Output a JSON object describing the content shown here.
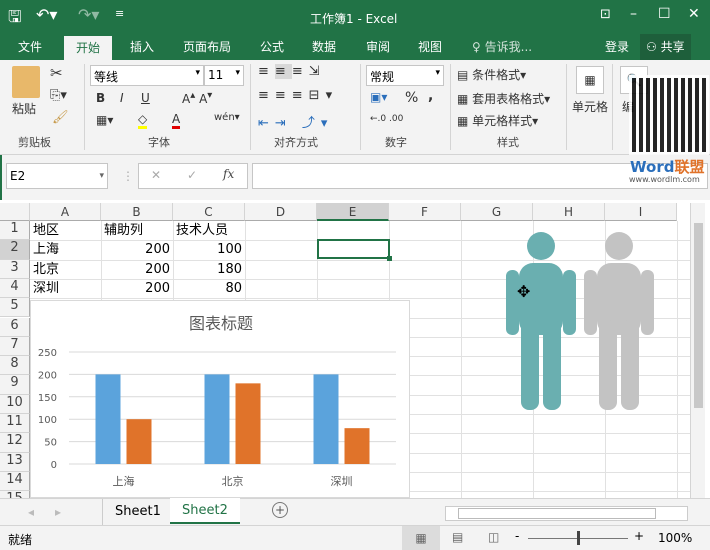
{
  "window": {
    "title": "工作簿1 - Excel",
    "accent": "#217346"
  },
  "tabs": [
    {
      "label": "文件"
    },
    {
      "label": "开始",
      "active": true
    },
    {
      "label": "插入"
    },
    {
      "label": "页面布局"
    },
    {
      "label": "公式"
    },
    {
      "label": "数据"
    },
    {
      "label": "审阅"
    },
    {
      "label": "视图"
    }
  ],
  "tell_me": "告诉我...",
  "signin": "登录",
  "share": "共享",
  "ribbon": {
    "clipboard": {
      "paste": "粘贴",
      "label": "剪贴板"
    },
    "font": {
      "name": "等线",
      "size": "11",
      "bold": "B",
      "italic": "I",
      "underline": "U",
      "label": "字体"
    },
    "alignment": {
      "label": "对齐方式"
    },
    "number": {
      "format": "常规",
      "percent": "%",
      "comma": ",",
      "label": "数字"
    },
    "styles": {
      "conditional": "条件格式",
      "table": "套用表格格式",
      "cell": "单元格样式",
      "label": "样式"
    },
    "cells": {
      "label": "单元格"
    },
    "editing": {
      "label": "编"
    }
  },
  "watermark": {
    "brand": "Word联盟",
    "url": "www.wordlm.com"
  },
  "formula_bar": {
    "name_box": "E2",
    "fx": "fx",
    "value": ""
  },
  "columns": [
    "A",
    "B",
    "C",
    "D",
    "E",
    "F",
    "G",
    "H",
    "I"
  ],
  "rows": [
    "1",
    "2",
    "3",
    "4",
    "5",
    "6",
    "7",
    "8",
    "9",
    "10",
    "11",
    "12",
    "13",
    "14",
    "15"
  ],
  "cells": [
    [
      "地区",
      "辅助列",
      "技术人员"
    ],
    [
      "上海",
      "200",
      "100"
    ],
    [
      "北京",
      "200",
      "180"
    ],
    [
      "深圳",
      "200",
      "80"
    ]
  ],
  "selected_cell": "E2",
  "chart_data": {
    "type": "bar",
    "title": "图表标题",
    "categories": [
      "上海",
      "北京",
      "深圳"
    ],
    "series": [
      {
        "values": [
          200,
          200,
          200
        ],
        "color": "#5ba3dc"
      },
      {
        "values": [
          100,
          180,
          80
        ],
        "color": "#e0732a"
      }
    ],
    "ylim": [
      0,
      250
    ],
    "yticks": [
      "0",
      "50",
      "100",
      "150",
      "200",
      "250"
    ],
    "grid": true
  },
  "people_icons": {
    "colors": [
      "#6aafb0",
      "#c3c3c3"
    ]
  },
  "sheets": [
    {
      "label": "Sheet1"
    },
    {
      "label": "Sheet2",
      "active": true
    }
  ],
  "status": {
    "text": "就绪",
    "zoom": "100%"
  }
}
